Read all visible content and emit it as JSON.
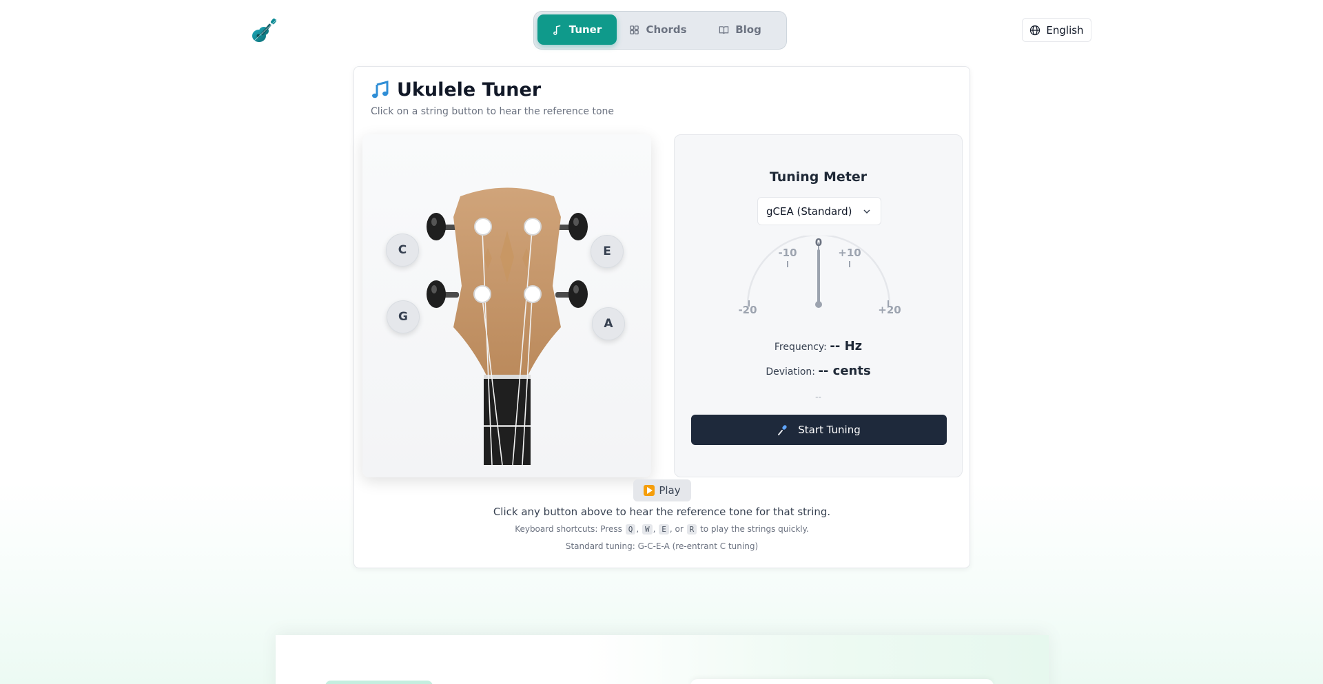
{
  "nav": {
    "items": [
      {
        "label": "Tuner",
        "icon": "music-note-icon",
        "active": true
      },
      {
        "label": "Chords",
        "icon": "grid-icon",
        "active": false
      },
      {
        "label": "Blog",
        "icon": "book-icon",
        "active": false
      }
    ]
  },
  "language": {
    "label": "English",
    "icon": "globe-icon"
  },
  "tuner": {
    "title": "Ukulele Tuner",
    "title_icon": "music-notes-emoji",
    "subtitle": "Click on a string button to hear the reference tone",
    "strings": {
      "top_left": "C",
      "top_right": "E",
      "bottom_left": "G",
      "bottom_right": "A"
    },
    "play_label": "Play",
    "help_text": "Click any button above to hear the reference tone for that string.",
    "shortcuts_prefix": "Keyboard shortcuts: Press",
    "shortcut_keys": [
      "Q",
      "W",
      "E",
      "R"
    ],
    "shortcut_sep1": ",",
    "shortcut_sep2": ",",
    "shortcut_sep3": ", or",
    "shortcuts_suffix": "to play the strings quickly.",
    "standard_note": "Standard tuning: G-C-E-A (re-entrant C tuning)"
  },
  "meter": {
    "title": "Tuning Meter",
    "tuning_selected": "gCEA (Standard)",
    "scale_labels": {
      "center": "0",
      "minus10": "-10",
      "plus10": "+10",
      "minus20": "-20",
      "plus20": "+20"
    },
    "frequency_label": "Frequency:",
    "frequency_value": "-- Hz",
    "deviation_label": "Deviation:",
    "deviation_value": "-- cents",
    "status": "--",
    "start_label": "Start Tuning",
    "start_icon": "microphone-icon"
  },
  "colors": {
    "accent": "#0f9a8b",
    "dark_button": "#1e293b",
    "headstock": "#c89a6e"
  }
}
